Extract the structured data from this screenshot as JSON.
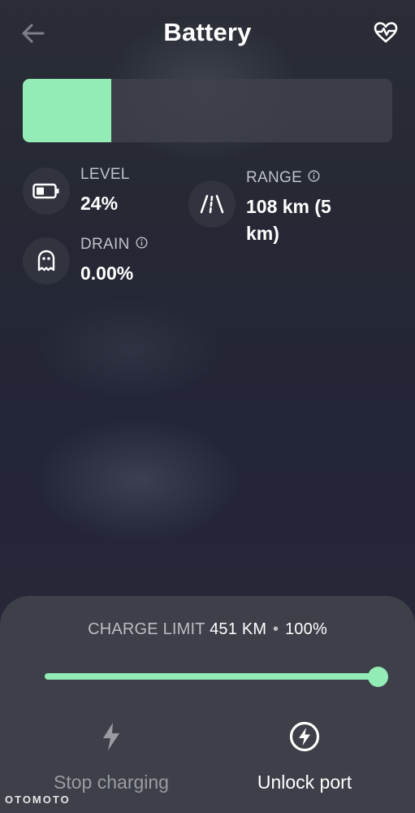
{
  "header": {
    "title": "Battery",
    "back_icon": "arrow-left-icon",
    "health_icon": "heart-pulse-icon"
  },
  "battery": {
    "level_percent": 24,
    "fill_color": "#93ebb5"
  },
  "stats": {
    "level": {
      "label": "LEVEL",
      "value": "24%",
      "icon": "battery-icon"
    },
    "range": {
      "label": "RANGE",
      "value": "108 km (5 km)",
      "icon": "road-icon",
      "info_icon": "info-icon"
    },
    "drain": {
      "label": "DRAIN",
      "value": "0.00%",
      "icon": "ghost-icon",
      "info_icon": "info-icon"
    }
  },
  "charge": {
    "limit_label": "CHARGE LIMIT",
    "limit_km": "451 KM",
    "separator": "•",
    "limit_percent": "100%",
    "slider_percent": 100
  },
  "actions": {
    "stop_label": "Stop charging",
    "stop_icon": "bolt-icon",
    "unlock_label": "Unlock port",
    "unlock_icon": "charge-port-icon"
  },
  "watermark": "OTOMOTO",
  "colors": {
    "accent": "#93ebb5",
    "background": "#272a38",
    "panel": "#3d4049",
    "muted_text": "#bfc1c8"
  }
}
